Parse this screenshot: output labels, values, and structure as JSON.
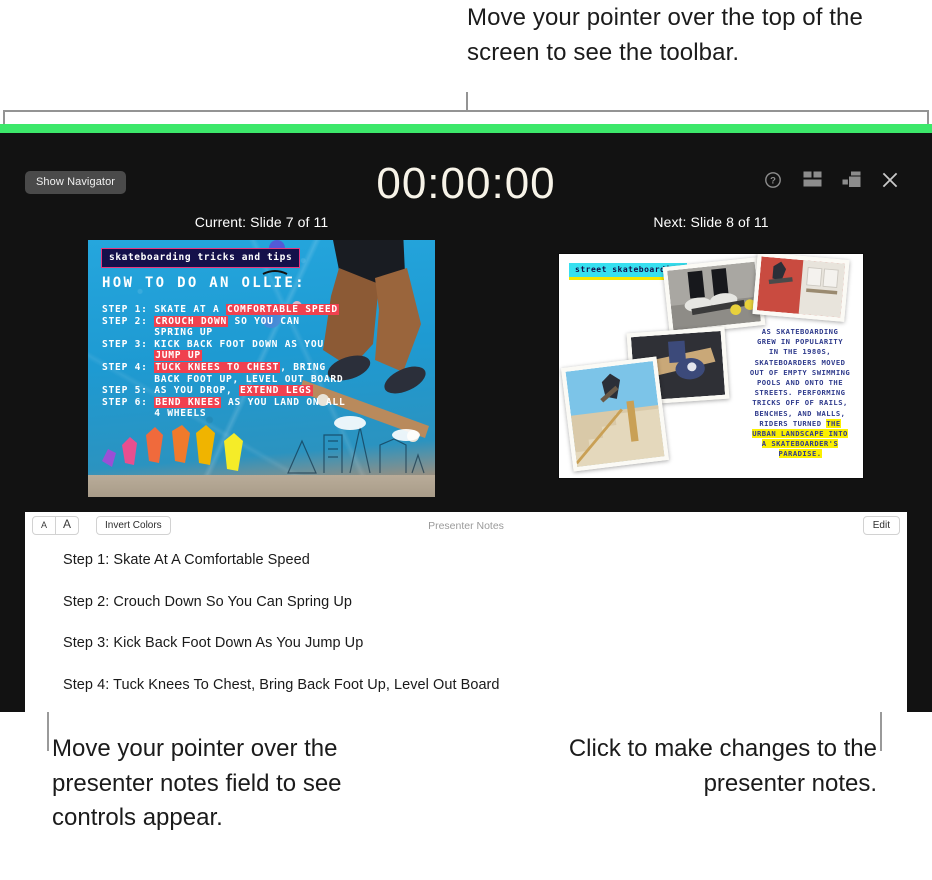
{
  "callouts": {
    "top": "Move your pointer over the top of the screen to see the toolbar.",
    "bottom_left": "Move your pointer over the presenter notes field to see controls appear.",
    "bottom_right": "Click to make changes to the presenter notes."
  },
  "presenter_display": {
    "accent_bar_color": "#3ce86a",
    "background_color": "#121212",
    "show_navigator_label": "Show Navigator",
    "timer": "00:00:00",
    "icons": [
      {
        "name": "help-icon",
        "label": "Help"
      },
      {
        "name": "layout-icon",
        "label": "Layout"
      },
      {
        "name": "rearrange-layout-icon",
        "label": "Rearrange Layout"
      },
      {
        "name": "close-icon",
        "label": "Close"
      }
    ]
  },
  "slides": {
    "current_label": "Current: Slide 7 of 11",
    "next_label": "Next: Slide 8 of 11",
    "current": {
      "tag": "skateboarding tricks and tips",
      "title": "HOW TO DO AN OLLIE:",
      "steps": [
        [
          {
            "t": "STEP 1: SKATE AT A ",
            "hl": false
          },
          {
            "t": "COMFORTABLE SPEED",
            "hl": true
          }
        ],
        [
          {
            "t": "STEP 2: ",
            "hl": false
          },
          {
            "t": "CROUCH DOWN",
            "hl": true
          },
          {
            "t": " SO YOU CAN",
            "hl": false
          }
        ],
        [
          {
            "t": "        SPRING UP",
            "hl": false
          }
        ],
        [
          {
            "t": "STEP 3: KICK BACK FOOT DOWN AS YOU",
            "hl": false
          }
        ],
        [
          {
            "t": "        ",
            "hl": false
          },
          {
            "t": "JUMP UP",
            "hl": true
          }
        ],
        [
          {
            "t": "STEP 4: ",
            "hl": false
          },
          {
            "t": "TUCK KNEES TO CHEST",
            "hl": true
          },
          {
            "t": ", BRING",
            "hl": false
          }
        ],
        [
          {
            "t": "        BACK FOOT UP, LEVEL OUT BOARD",
            "hl": false
          }
        ],
        [
          {
            "t": "STEP 5: AS YOU DROP, ",
            "hl": false
          },
          {
            "t": "EXTEND LEGS",
            "hl": true
          }
        ],
        [
          {
            "t": "STEP 6: ",
            "hl": false
          },
          {
            "t": "BEND KNEES",
            "hl": true
          },
          {
            "t": " AS YOU LAND ON ALL",
            "hl": false
          }
        ],
        [
          {
            "t": "        4 WHEELS",
            "hl": false
          }
        ]
      ]
    },
    "next": {
      "tag": "street skateboarding",
      "body_lines": [
        {
          "t": "AS SKATEBOARDING",
          "hl": false
        },
        {
          "t": "GREW IN POPULARITY",
          "hl": false
        },
        {
          "t": "IN THE 1980S,",
          "hl": false
        },
        {
          "t": "SKATEBOARDERS MOVED",
          "hl": false
        },
        {
          "t": "OUT OF EMPTY SWIMMING",
          "hl": false
        },
        {
          "t": "POOLS AND ONTO THE",
          "hl": false
        },
        {
          "t": "STREETS. PERFORMING",
          "hl": false
        },
        {
          "t": "TRICKS OFF OF RAILS,",
          "hl": false
        },
        {
          "t": "BENCHES, AND WALLS,",
          "hl": false
        },
        {
          "t": "RIDERS TURNED THE",
          "hl": "partial"
        },
        {
          "t": "URBAN LANDSCAPE INTO",
          "hl": true
        },
        {
          "t": "A SKATEBOARDER'S",
          "hl": true
        },
        {
          "t": "PARADISE.",
          "hl": true
        }
      ]
    }
  },
  "notes": {
    "title": "Presenter Notes",
    "font_smaller_label": "A",
    "font_larger_label": "A",
    "invert_label": "Invert Colors",
    "edit_label": "Edit",
    "lines": [
      "Step 1: Skate At A Comfortable Speed",
      "Step 2: Crouch Down So You Can Spring Up",
      "Step 3: Kick Back Foot Down As You Jump Up",
      "Step 4: Tuck Knees To Chest, Bring Back Foot Up, Level Out Board"
    ]
  }
}
